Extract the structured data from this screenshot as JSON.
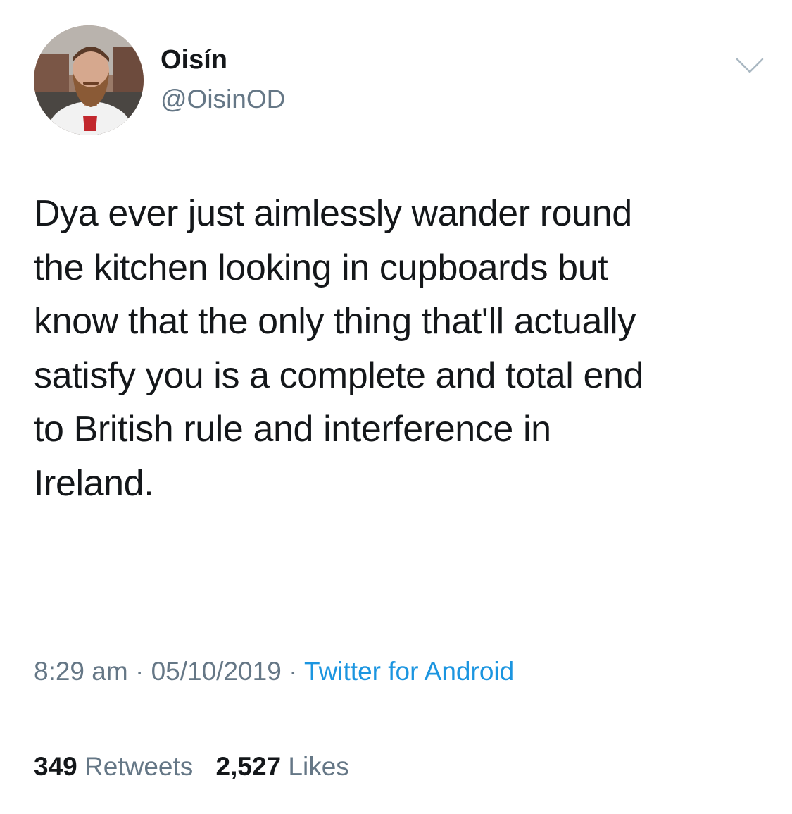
{
  "author": {
    "display_name": "Oisín",
    "handle": "@OisinOD",
    "avatar_icon": "profile-photo"
  },
  "menu": {
    "icon": "chevron-down-icon"
  },
  "tweet": {
    "text": "Dya ever just aimlessly wander round\nthe kitchen looking in cupboards but\nknow that the only thing that'll actually\nsatisfy you is a complete and total end\nto British rule and interference in\nIreland.",
    "time": "8:29 am",
    "separator": "·",
    "date": "05/10/2019",
    "source": "Twitter for Android"
  },
  "stats": {
    "retweets_count": "349",
    "retweets_label": "Retweets",
    "likes_count": "2,527",
    "likes_label": "Likes"
  },
  "colors": {
    "text": "#14171a",
    "secondary": "#657786",
    "link": "#1b95e0",
    "divider": "#dde3e8"
  }
}
